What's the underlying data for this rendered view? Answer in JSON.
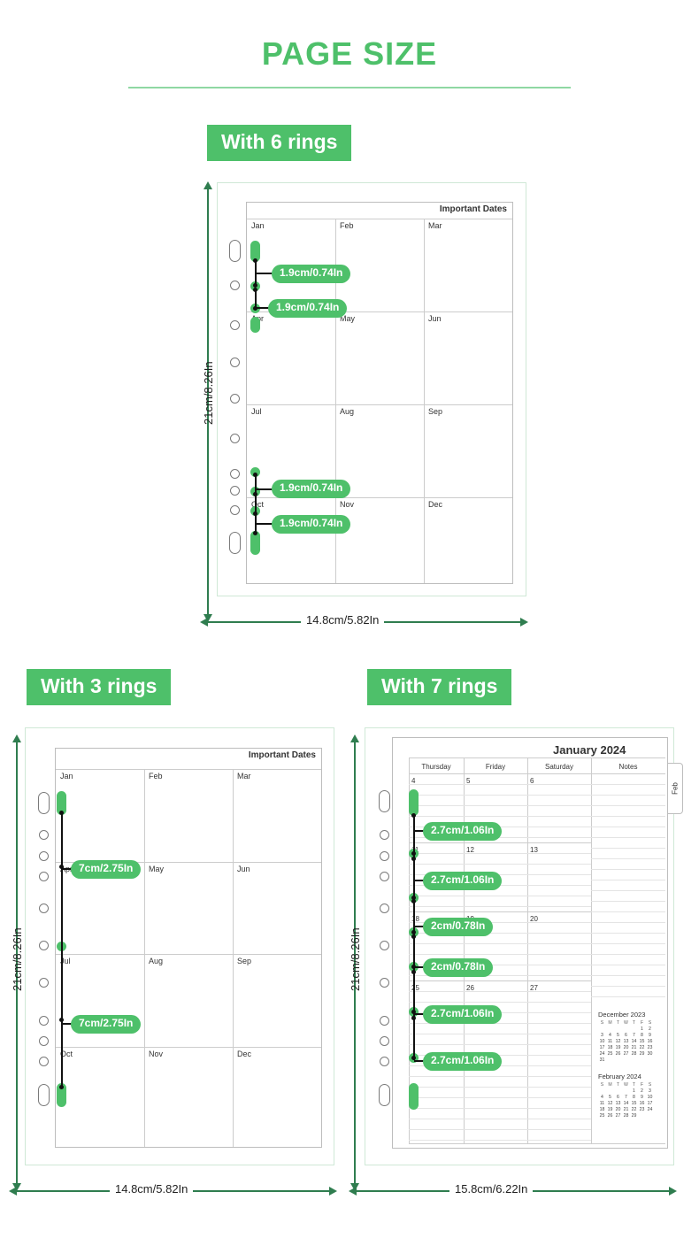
{
  "header": {
    "title": "PAGE SIZE"
  },
  "sections": {
    "six": {
      "tag": "With 6 rings",
      "sheet_header": "Important Dates",
      "months": [
        "Jan",
        "Feb",
        "Mar",
        "Apr",
        "May",
        "Jun",
        "Jul",
        "Aug",
        "Sep",
        "Oct",
        "Nov",
        "Dec"
      ],
      "spacings": [
        "1.9cm/0.74In",
        "1.9cm/0.74In",
        "1.9cm/0.74In",
        "1.9cm/0.74In"
      ],
      "height": "21cm/8.26In",
      "width": "14.8cm/5.82In"
    },
    "three": {
      "tag": "With 3 rings",
      "sheet_header": "Important Dates",
      "months": [
        "Jan",
        "Feb",
        "Mar",
        "Apr",
        "May",
        "Jun",
        "Jul",
        "Aug",
        "Sep",
        "Oct",
        "Nov",
        "Dec"
      ],
      "spacings": [
        "7cm/2.75In",
        "7cm/2.75In"
      ],
      "height": "21cm/8.26In",
      "width": "14.8cm/5.82In"
    },
    "seven": {
      "tag": "With 7 rings",
      "sheet_header": "January 2024",
      "columns": [
        "Thursday",
        "Friday",
        "Saturday",
        "Notes"
      ],
      "day_numbers": [
        "4",
        "5",
        "6",
        "11",
        "12",
        "13",
        "18",
        "19",
        "20",
        "25",
        "26",
        "27"
      ],
      "tab_label": "Feb",
      "spacings": [
        "2.7cm/1.06In",
        "2.7cm/1.06In",
        "2cm/0.78In",
        "2cm/0.78In",
        "2.7cm/1.06In",
        "2.7cm/1.06In"
      ],
      "height": "21cm/8.26In",
      "width": "15.8cm/6.22In",
      "mini_calendars": [
        {
          "title": "December 2023",
          "head": [
            "S",
            "M",
            "T",
            "W",
            "T",
            "F",
            "S"
          ],
          "weeks": [
            [
              "",
              "",
              "",
              "",
              "",
              "1",
              "2"
            ],
            [
              "3",
              "4",
              "5",
              "6",
              "7",
              "8",
              "9"
            ],
            [
              "10",
              "11",
              "12",
              "13",
              "14",
              "15",
              "16"
            ],
            [
              "17",
              "18",
              "19",
              "20",
              "21",
              "22",
              "23"
            ],
            [
              "24",
              "25",
              "26",
              "27",
              "28",
              "29",
              "30"
            ],
            [
              "31",
              "",
              "",
              "",
              "",
              "",
              ""
            ]
          ]
        },
        {
          "title": "February 2024",
          "head": [
            "S",
            "M",
            "T",
            "W",
            "T",
            "F",
            "S"
          ],
          "weeks": [
            [
              "",
              "",
              "",
              "",
              "1",
              "2",
              "3"
            ],
            [
              "4",
              "5",
              "6",
              "7",
              "8",
              "9",
              "10"
            ],
            [
              "11",
              "12",
              "13",
              "14",
              "15",
              "16",
              "17"
            ],
            [
              "18",
              "19",
              "20",
              "21",
              "22",
              "23",
              "24"
            ],
            [
              "25",
              "26",
              "27",
              "28",
              "29",
              "",
              ""
            ]
          ]
        }
      ]
    }
  },
  "colors": {
    "accent": "#4ec06a",
    "dim": "#2f7d4f",
    "panel_border": "#cfe8d6"
  }
}
